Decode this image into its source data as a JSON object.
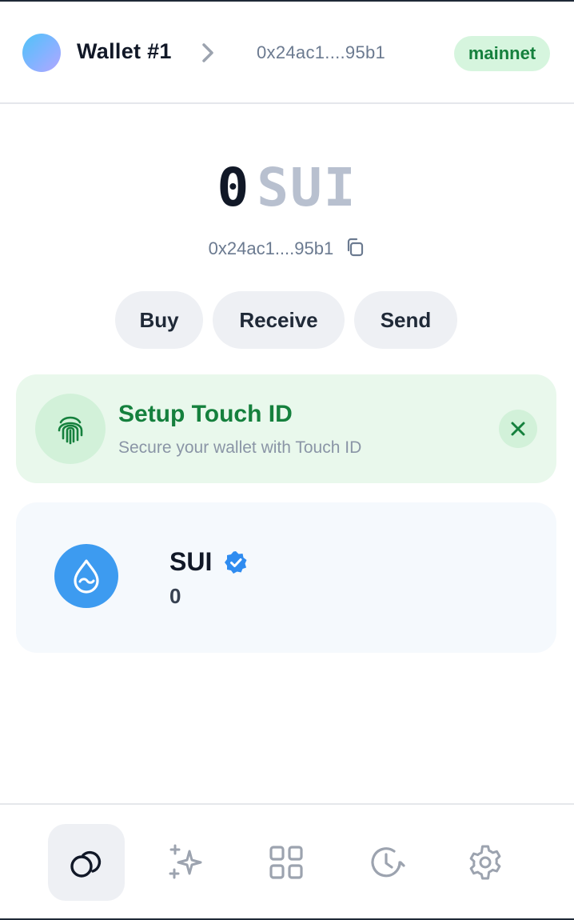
{
  "header": {
    "wallet_name": "Wallet #1",
    "address": "0x24ac1....95b1",
    "network": "mainnet",
    "chevron_icon": "chevron-right-icon",
    "avatar_gradient": [
      "#4fc3f7",
      "#7fb4ff",
      "#b3a6ff"
    ]
  },
  "balance": {
    "amount": "0",
    "unit": "SUI",
    "address": "0x24ac1....95b1",
    "copy_icon": "copy-icon"
  },
  "actions": {
    "buy": "Buy",
    "receive": "Receive",
    "send": "Send"
  },
  "touch_id": {
    "title": "Setup Touch ID",
    "subtitle": "Secure your wallet with Touch ID",
    "icon": "fingerprint-icon",
    "close_icon": "close-icon"
  },
  "assets": [
    {
      "symbol": "SUI",
      "balance": "0",
      "verified": true,
      "icon": "sui-drop-icon",
      "color": "#3d9bf0"
    }
  ],
  "nav": {
    "items": [
      "tokens",
      "apps",
      "assets",
      "activity",
      "settings"
    ],
    "active": "tokens"
  },
  "colors": {
    "accent_green": "#15803d",
    "badge_green_bg": "#d6f5de",
    "sui_blue": "#3d9bf0",
    "muted_text": "#6b7a90"
  }
}
